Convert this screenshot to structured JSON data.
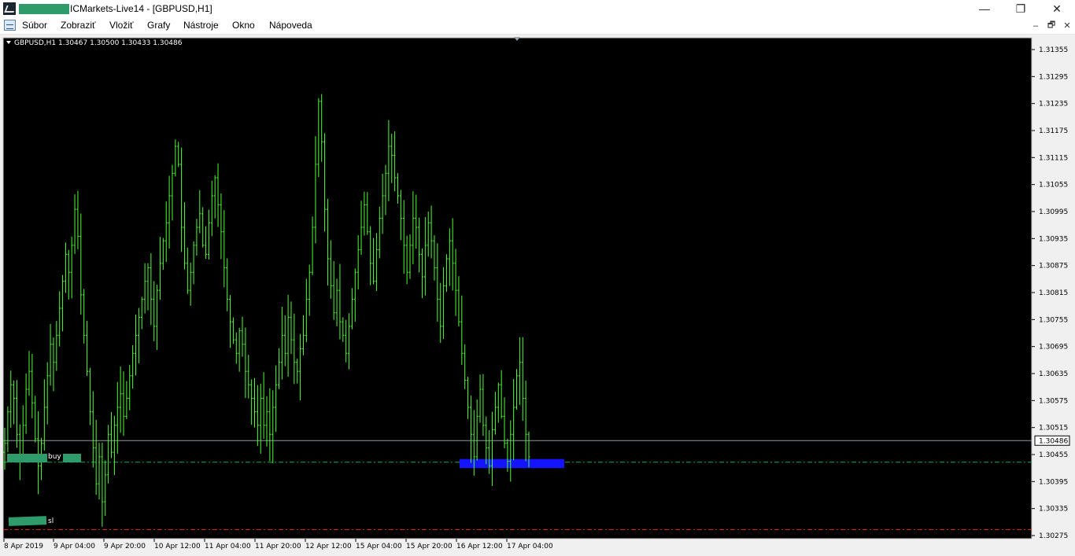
{
  "window": {
    "title": "ICMarkets-Live14 - [GBPUSD,H1]",
    "minimize": "—",
    "restore": "❐",
    "close": "✕"
  },
  "menu": {
    "items": [
      "Súbor",
      "Zobraziť",
      "Vložiť",
      "Grafy",
      "Nástroje",
      "Okno",
      "Nápoveda"
    ],
    "mdi_minimize": "–",
    "mdi_restore": "🗗",
    "mdi_close": "✕"
  },
  "chart": {
    "symbol_info": "GBPUSD,H1  1.30467 1.30500 1.30433 1.30486",
    "current_price": "1.30486",
    "buy_label": "buy",
    "sl_label": "sl",
    "colors": {
      "background": "#000000",
      "candle": "#4cff2e",
      "buy_line": "#00b050",
      "sl_line": "#e02020",
      "bid_line": "#8a9aa3",
      "zone": "#1414ff"
    }
  },
  "chart_data": {
    "type": "candlestick",
    "price_axis_ticks": [
      "1.31355",
      "1.31295",
      "1.31235",
      "1.31175",
      "1.31115",
      "1.31055",
      "1.30995",
      "1.30935",
      "1.30875",
      "1.30815",
      "1.30755",
      "1.30695",
      "1.30635",
      "1.30575",
      "1.30515",
      "1.30455",
      "1.30395",
      "1.30335",
      "1.30275"
    ],
    "time_axis_ticks": [
      "8 Apr 2019",
      "9 Apr 04:00",
      "9 Apr 20:00",
      "10 Apr 12:00",
      "11 Apr 04:00",
      "11 Apr 20:00",
      "12 Apr 12:00",
      "15 Apr 04:00",
      "15 Apr 20:00",
      "16 Apr 12:00",
      "17 Apr 04:00"
    ],
    "ylim": [
      1.3027,
      1.3139
    ],
    "bid": 1.30486,
    "buy_level": 1.30438,
    "sl_level": 1.30288,
    "zone": {
      "from": 1.30425,
      "to": 1.30445
    },
    "series": [
      {
        "values": [
          1.3048,
          1.3055,
          1.3061,
          1.3058,
          1.305,
          1.3045,
          1.3052,
          1.306,
          1.3064,
          1.3057,
          1.3049,
          1.3043,
          1.3048,
          1.3056,
          1.3063,
          1.307,
          1.3066,
          1.3072,
          1.3078,
          1.3084,
          1.309,
          1.3086,
          1.3092,
          1.31,
          1.3094,
          1.3081,
          1.3072,
          1.3064,
          1.3055,
          1.3047,
          1.3039,
          1.3045,
          1.3035,
          1.3041,
          1.305,
          1.3046,
          1.3052,
          1.3056,
          1.3059,
          1.3054,
          1.3058,
          1.3063,
          1.3068,
          1.3072,
          1.3076,
          1.308,
          1.3084,
          1.3087,
          1.308,
          1.3074,
          1.3082,
          1.3088,
          1.3093,
          1.3097,
          1.3103,
          1.3108,
          1.3114,
          1.311,
          1.3096,
          1.3088,
          1.3082,
          1.3086,
          1.3092,
          1.3096,
          1.3099,
          1.3092,
          1.309,
          1.3097,
          1.3103,
          1.3107,
          1.3101,
          1.3095,
          1.3087,
          1.308,
          1.3075,
          1.3071,
          1.3068,
          1.3073,
          1.307,
          1.3064,
          1.3061,
          1.3058,
          1.3055,
          1.3052,
          1.3058,
          1.3052,
          1.3055,
          1.305,
          1.3056,
          1.3061,
          1.3066,
          1.3072,
          1.3068,
          1.3076,
          1.3071,
          1.3066,
          1.3064,
          1.3069,
          1.3072,
          1.308,
          1.3086,
          1.3096,
          1.311,
          1.3124,
          1.3115,
          1.31,
          1.3089,
          1.3083,
          1.3077,
          1.3082,
          1.3075,
          1.3072,
          1.3068,
          1.3074,
          1.308,
          1.3086,
          1.3091,
          1.3096,
          1.3101,
          1.3095,
          1.3088,
          1.3084,
          1.3091,
          1.3098,
          1.3103,
          1.3108,
          1.3114,
          1.3112,
          1.3107,
          1.3103,
          1.3098,
          1.3092,
          1.3086,
          1.3092,
          1.3098,
          1.3096,
          1.309,
          1.3085,
          1.3092,
          1.3097,
          1.3093,
          1.3087,
          1.308,
          1.3074,
          1.3083,
          1.3089,
          1.3093,
          1.3088,
          1.3082,
          1.3075,
          1.3068,
          1.3062,
          1.3056,
          1.305,
          1.3045,
          1.3054,
          1.306,
          1.3052,
          1.3047,
          1.3043,
          1.3051,
          1.3056,
          1.3061,
          1.3054,
          1.3048,
          1.3044,
          1.305,
          1.3056,
          1.3063,
          1.3066,
          1.3058,
          1.305,
          1.3045
        ]
      }
    ]
  }
}
